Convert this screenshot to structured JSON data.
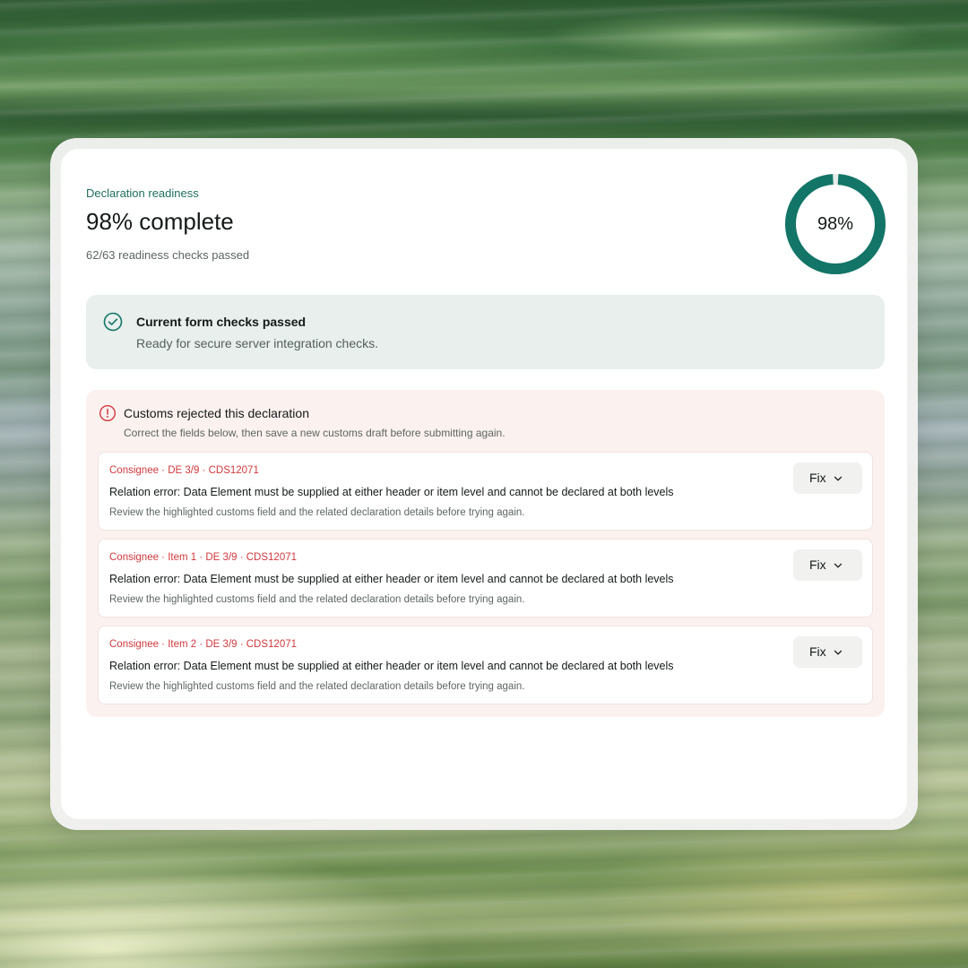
{
  "readiness": {
    "eyebrow": "Declaration readiness",
    "headline": "98% complete",
    "checks_summary": "62/63 readiness checks passed",
    "progress_label": "98%",
    "progress_fraction": 0.98,
    "accent_color": "#127567"
  },
  "success_banner": {
    "icon": "check-circle-icon",
    "title": "Current form checks passed",
    "description": "Ready for secure server integration checks."
  },
  "rejection": {
    "icon": "alert-circle-icon",
    "title": "Customs rejected this declaration",
    "description": "Correct the fields below, then save a new customs draft before submitting again.",
    "error_color": "#d0393d",
    "errors": [
      {
        "reference": "Consignee · DE 3/9 · CDS12071",
        "message": "Relation error: Data Element must be supplied at either header or item level and cannot be declared at both levels",
        "hint": "Review the highlighted customs field and the related declaration details before trying again.",
        "action_label": "Fix"
      },
      {
        "reference": "Consignee · Item 1 · DE 3/9 · CDS12071",
        "message": "Relation error: Data Element must be supplied at either header or item level and cannot be declared at both levels",
        "hint": "Review the highlighted customs field and the related declaration details before trying again.",
        "action_label": "Fix"
      },
      {
        "reference": "Consignee · Item 2 · DE 3/9 · CDS12071",
        "message": "Relation error: Data Element must be supplied at either header or item level and cannot be declared at both levels",
        "hint": "Review the highlighted customs field and the related declaration details before trying again.",
        "action_label": "Fix"
      }
    ]
  }
}
